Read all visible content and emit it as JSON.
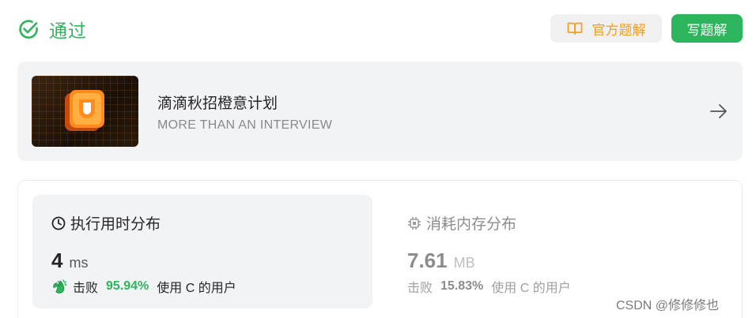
{
  "header": {
    "status_label": "通过",
    "official_solution_label": "官方题解",
    "write_solution_label": "写题解"
  },
  "banner": {
    "title": "滴滴秋招橙意计划",
    "subtitle": "MORE THAN AN INTERVIEW"
  },
  "runtime": {
    "title": "执行用时分布",
    "value": "4",
    "unit": "ms",
    "beat_prefix": "击败",
    "beat_percent": "95.94%",
    "beat_suffix": "使用 C 的用户"
  },
  "memory": {
    "title": "消耗内存分布",
    "value": "7.61",
    "unit": "MB",
    "beat_prefix": "击败",
    "beat_percent": "15.83%",
    "beat_suffix": "使用 C 的用户"
  },
  "watermark": "CSDN @修修修也",
  "colors": {
    "success": "#2db55d",
    "official": "#f0a020",
    "panel": "#f2f3f5"
  },
  "icons": [
    "check-circle-icon",
    "book-icon",
    "arrow-right-icon",
    "clock-icon",
    "chip-icon",
    "clap-icon",
    "didi-logo"
  ]
}
